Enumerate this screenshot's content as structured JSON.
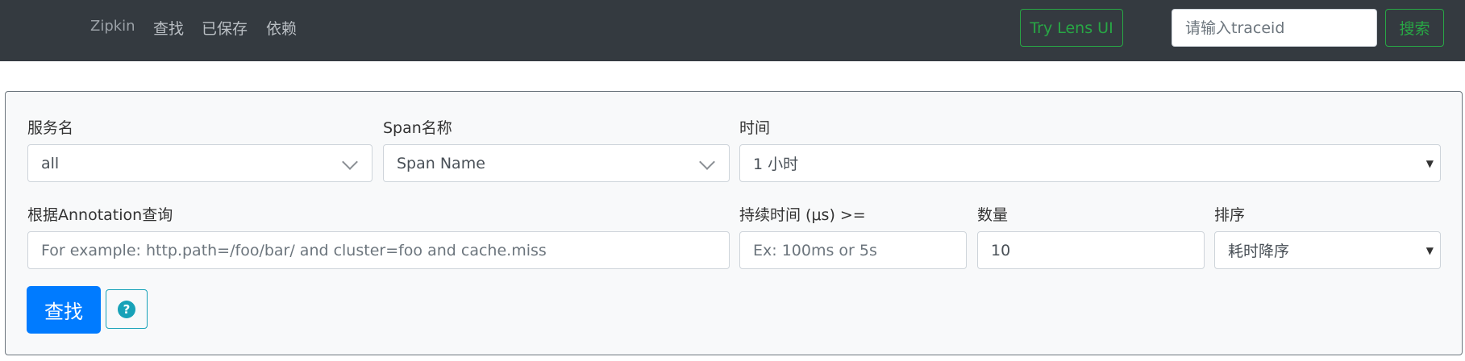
{
  "navbar": {
    "brand": "Zipkin",
    "links": [
      "查找",
      "已保存",
      "依赖"
    ],
    "lens_button": "Try Lens UI",
    "traceid_placeholder": "请输入traceid",
    "search_button": "搜索"
  },
  "form": {
    "service": {
      "label": "服务名",
      "value": "all"
    },
    "span": {
      "label": "Span名称",
      "value": "Span Name"
    },
    "time": {
      "label": "时间",
      "value": "1 小时"
    },
    "annotation": {
      "label": "根据Annotation查询",
      "placeholder": "For example: http.path=/foo/bar/ and cluster=foo and cache.miss"
    },
    "duration": {
      "label": "持续时间 (μs) >=",
      "placeholder": "Ex: 100ms or 5s"
    },
    "limit": {
      "label": "数量",
      "value": "10"
    },
    "sort": {
      "label": "排序",
      "value": "耗时降序"
    },
    "find_button": "查找",
    "help_glyph": "?"
  },
  "colors": {
    "navbar_bg": "#343a40",
    "success": "#28a745",
    "primary": "#007bff",
    "info": "#17a2b8"
  },
  "icons": [
    "chevron-down-icon",
    "caret-down-icon",
    "question-circle-icon"
  ]
}
